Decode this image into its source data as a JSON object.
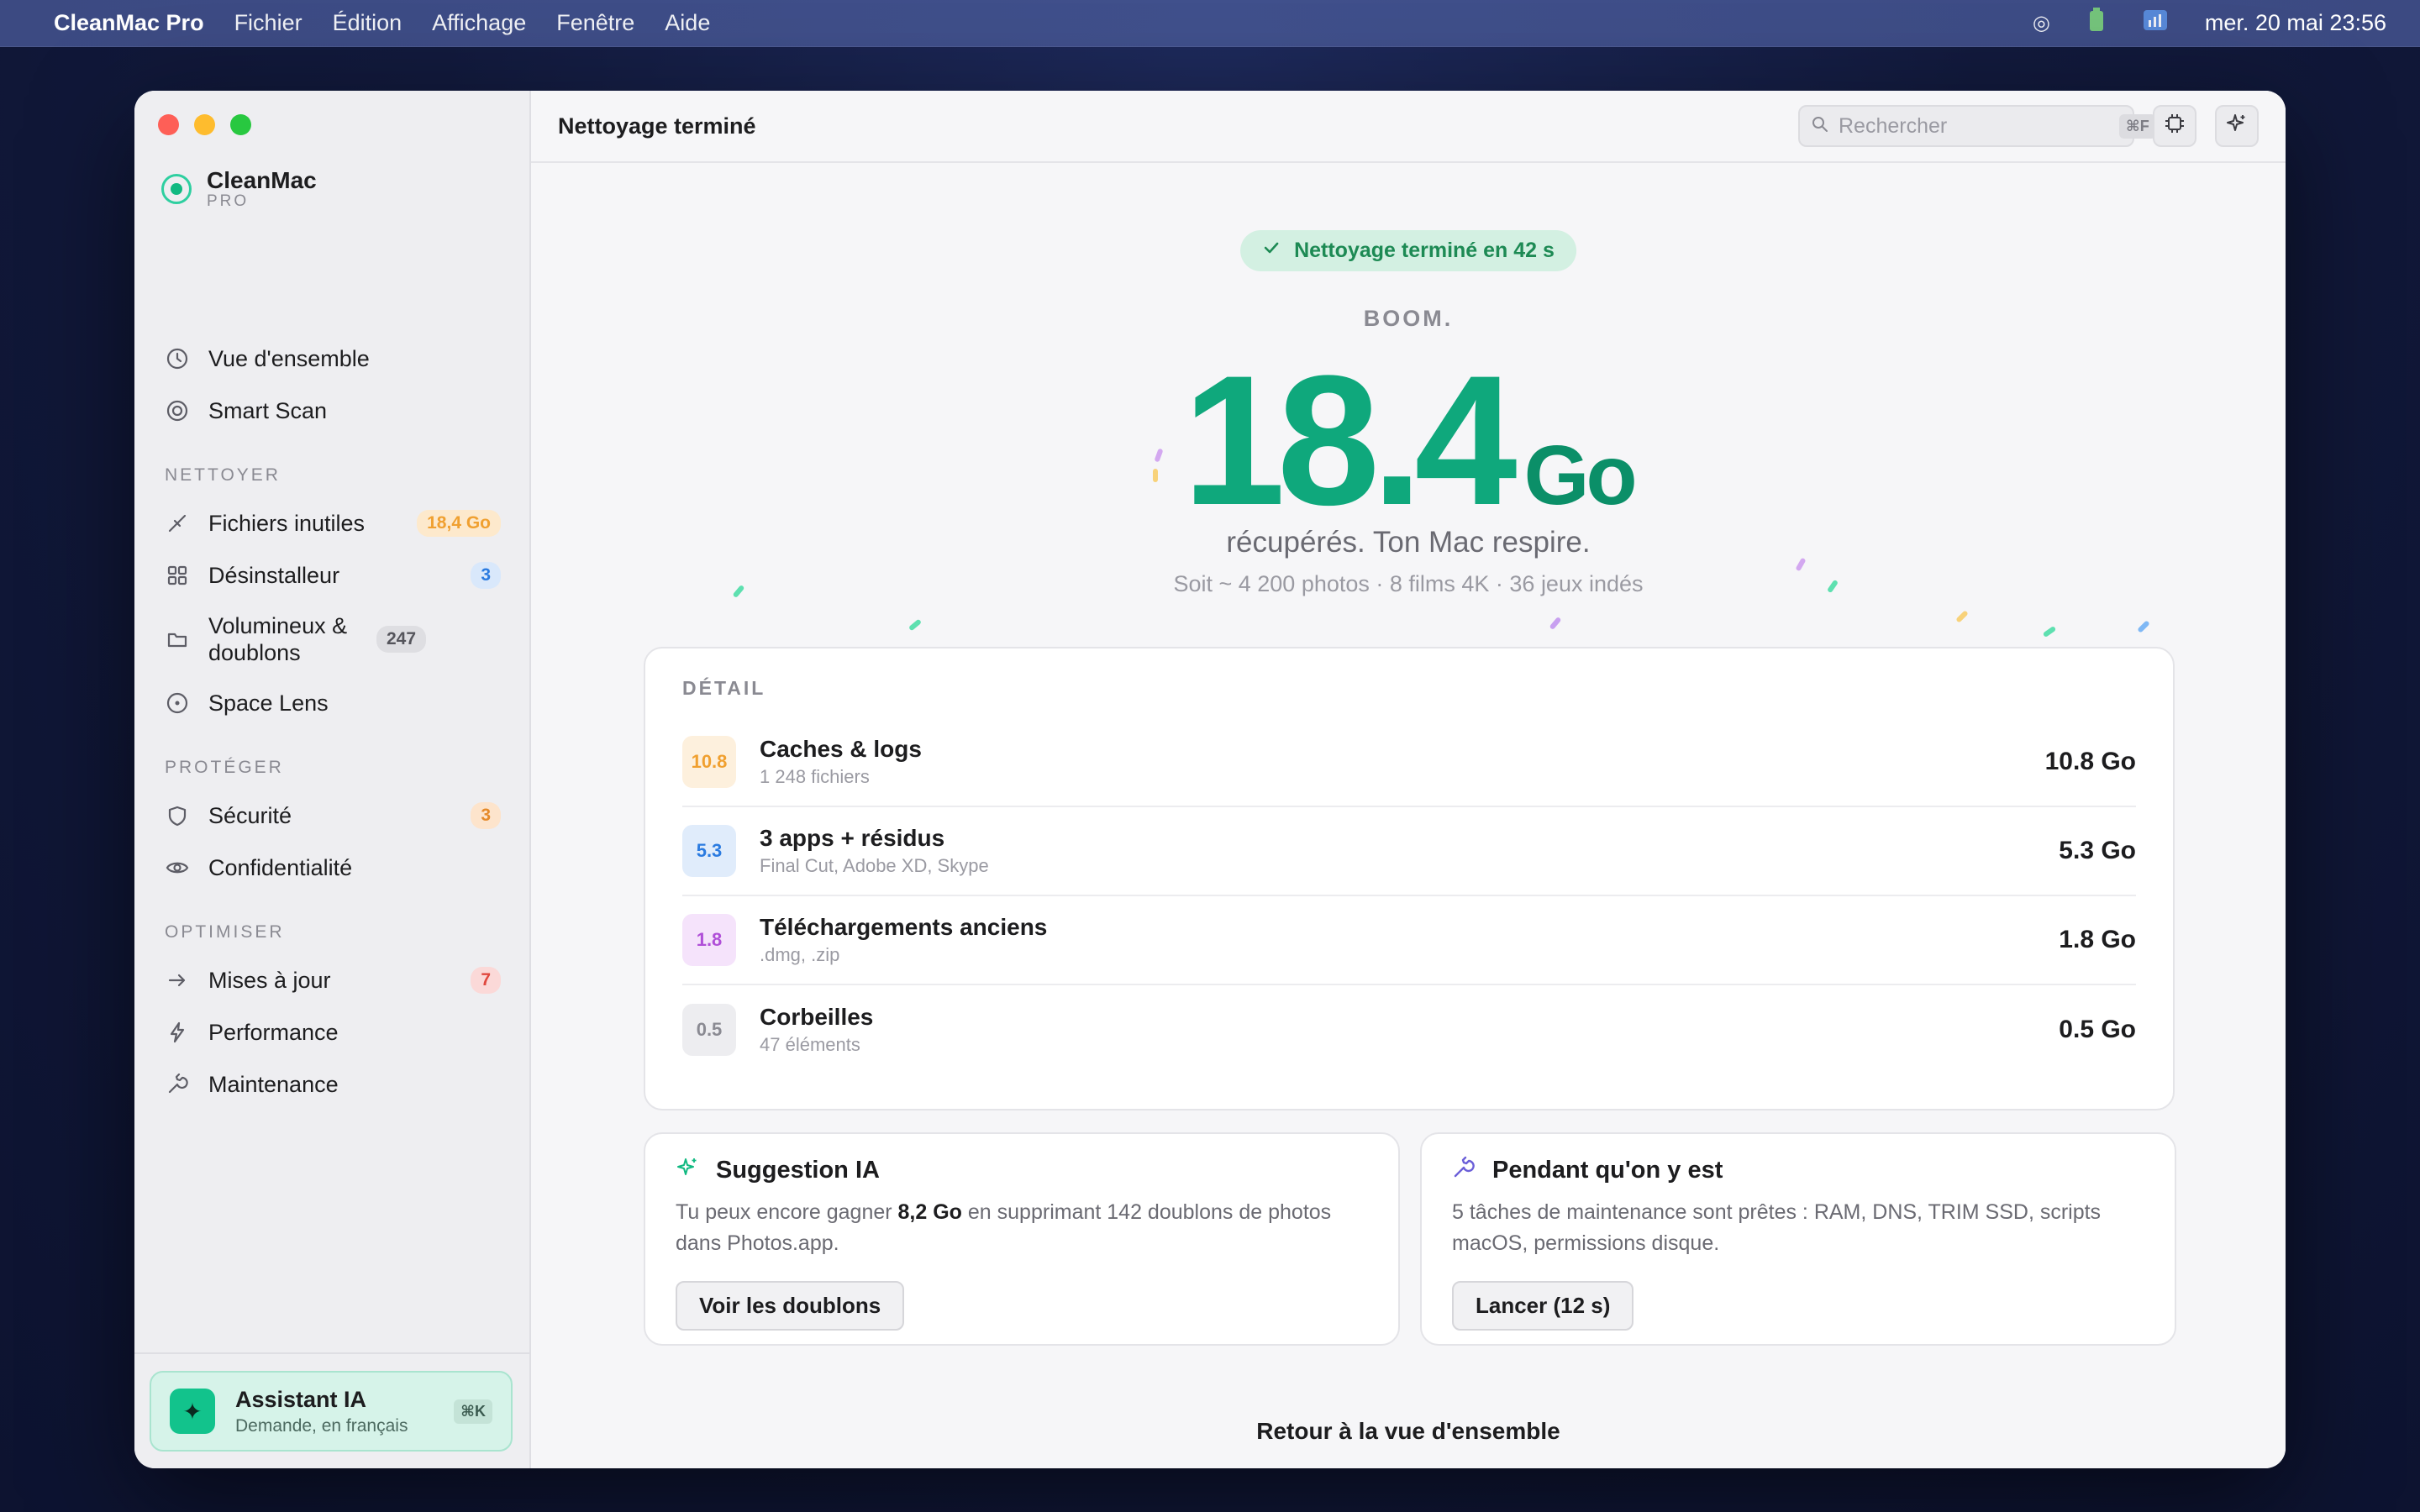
{
  "menubar": {
    "app_name": "CleanMac Pro",
    "menus": [
      "Fichier",
      "Édition",
      "Affichage",
      "Fenêtre",
      "Aide"
    ],
    "clock": "mer. 20 mai 23:56"
  },
  "sidebar": {
    "brand": {
      "name": "CleanMac",
      "tier": "PRO"
    },
    "items_top": [
      {
        "label": "Vue d'ensemble",
        "icon": "clock-icon"
      },
      {
        "label": "Smart Scan",
        "icon": "target-icon"
      }
    ],
    "sections": [
      {
        "label": "NETTOYER",
        "items": [
          {
            "label": "Fichiers inutiles",
            "badge": "18,4 Go",
            "icon": "broom-icon"
          },
          {
            "label": "Désinstalleur",
            "badge": "3",
            "icon": "grid-icon"
          },
          {
            "label": "Volumineux & doublons",
            "badge": "247",
            "icon": "folder-icon"
          },
          {
            "label": "Space Lens",
            "icon": "disc-icon"
          }
        ]
      },
      {
        "label": "PROTÉGER",
        "items": [
          {
            "label": "Sécurité",
            "badge": "3",
            "icon": "shield-icon"
          },
          {
            "label": "Confidentialité",
            "icon": "eye-icon"
          }
        ]
      },
      {
        "label": "OPTIMISER",
        "items": [
          {
            "label": "Mises à jour",
            "badge": "7",
            "icon": "arrow-right-icon"
          },
          {
            "label": "Performance",
            "icon": "bolt-icon"
          },
          {
            "label": "Maintenance",
            "icon": "wrench-icon"
          }
        ]
      }
    ],
    "assistant": {
      "title": "Assistant IA",
      "subtitle": "Demande, en français",
      "shortcut": "⌘K"
    }
  },
  "toolbar": {
    "title": "Nettoyage terminé",
    "search_placeholder": "Rechercher",
    "search_shortcut": "⌘F"
  },
  "result": {
    "status": "Nettoyage terminé en 42 s",
    "kicker": "BOOM.",
    "amount": "18.4",
    "unit": "Go",
    "headline": "récupérés. Ton Mac respire.",
    "equivalent": "Soit ~ 4 200 photos · 8 films 4K · 36 jeux indés"
  },
  "detail": {
    "label": "DÉTAIL",
    "rows": [
      {
        "chip": "10.8",
        "title": "Caches & logs",
        "sub": "1 248 fichiers",
        "value": "10.8 Go"
      },
      {
        "chip": "5.3",
        "title": "3 apps + résidus",
        "sub": "Final Cut, Adobe XD, Skype",
        "value": "5.3 Go"
      },
      {
        "chip": "1.8",
        "title": "Téléchargements anciens",
        "sub": ".dmg, .zip",
        "value": "1.8 Go"
      },
      {
        "chip": "0.5",
        "title": "Corbeilles",
        "sub": "47 éléments",
        "value": "0.5 Go"
      }
    ]
  },
  "cards": {
    "suggestion": {
      "title": "Suggestion IA",
      "body_pre": "Tu peux encore gagner ",
      "body_bold": "8,2 Go",
      "body_post": " en supprimant 142 doublons de photos dans Photos.app.",
      "button": "Voir les doublons"
    },
    "maintenance": {
      "title": "Pendant qu'on y est",
      "body": "5 tâches de maintenance sont prêtes : RAM, DNS, TRIM SSD, scripts macOS, permissions disque.",
      "button": "Lancer (12 s)"
    }
  },
  "footer_link": "Retour à la vue d'ensemble",
  "colors": {
    "accent": "#0fa87c",
    "chip_orange": "#f0a030",
    "chip_blue": "#2b7be0",
    "chip_purple": "#b04fd8",
    "chip_gray": "#8a8a92"
  }
}
